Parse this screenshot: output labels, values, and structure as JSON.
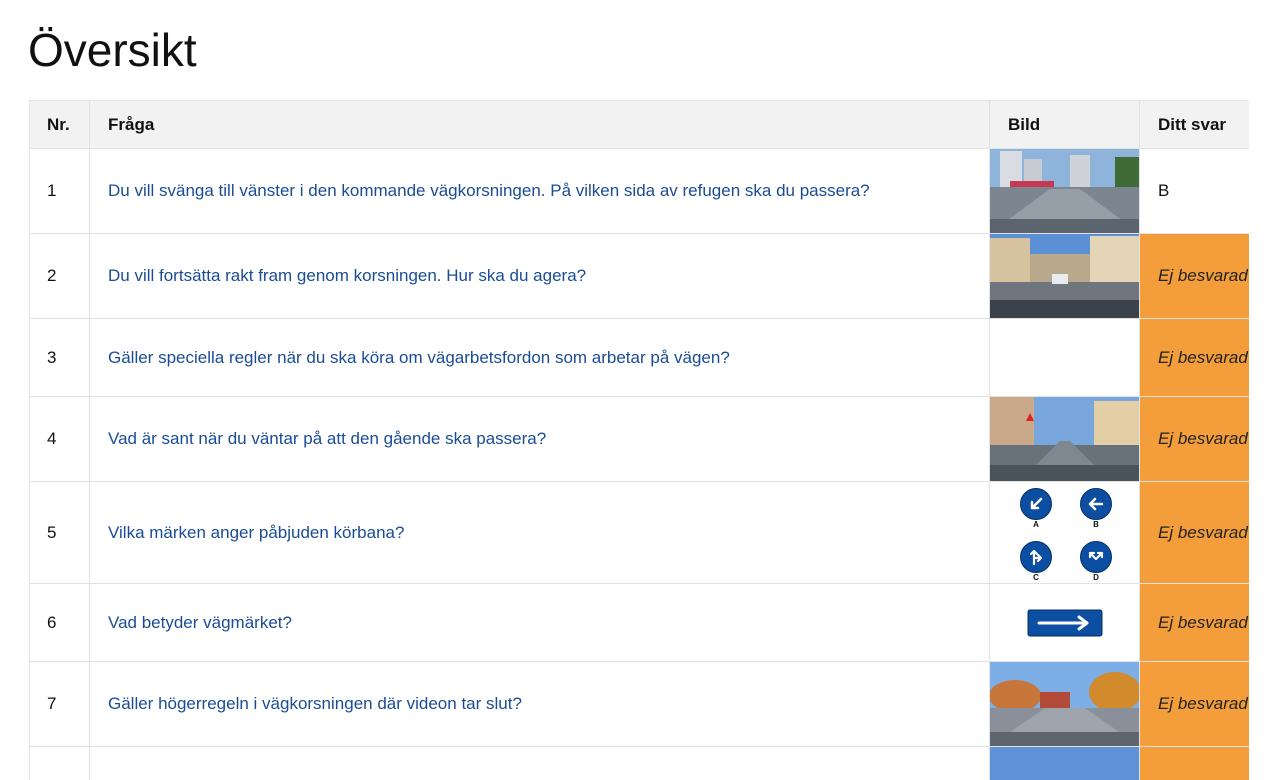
{
  "page": {
    "title": "Översikt"
  },
  "table": {
    "headers": {
      "nr": "Nr.",
      "question": "Fråga",
      "image": "Bild",
      "answer": "Ditt svar"
    },
    "rows": [
      {
        "nr": "1",
        "question": "Du vill svänga till vänster i den kommande vägkorsningen. På vilken sida av refugen ska du passera?",
        "image": "street-photo-intersection",
        "answer": "B",
        "answered": true
      },
      {
        "nr": "2",
        "question": "Du vill fortsätta rakt fram genom korsningen. Hur ska du agera?",
        "image": "street-photo-town",
        "answer": "Ej besvarad",
        "answered": false
      },
      {
        "nr": "3",
        "question": "Gäller speciella regler när du ska köra om vägarbetsfordon som arbetar på vägen?",
        "image": "",
        "answer": "Ej besvarad",
        "answered": false
      },
      {
        "nr": "4",
        "question": "Vad är sant när du väntar på att den gående ska passera?",
        "image": "street-photo-crossing",
        "answer": "Ej besvarad",
        "answered": false
      },
      {
        "nr": "5",
        "question": "Vilka märken anger påbjuden körbana?",
        "image": "road-signs-abcd",
        "answer": "Ej besvarad",
        "answered": false,
        "sign_labels": [
          "A",
          "B",
          "C",
          "D"
        ]
      },
      {
        "nr": "6",
        "question": "Vad betyder vägmärket?",
        "image": "one-way-sign",
        "answer": "Ej besvarad",
        "answered": false
      },
      {
        "nr": "7",
        "question": "Gäller högerregeln i vägkorsningen där videon tar slut?",
        "image": "street-photo-autumn",
        "answer": "Ej besvarad",
        "answered": false
      }
    ]
  },
  "colors": {
    "link": "#1a4c96",
    "unanswered_bg": "#f39e3a",
    "header_bg": "#f2f2f2",
    "sign_blue": "#0b4ea2"
  }
}
